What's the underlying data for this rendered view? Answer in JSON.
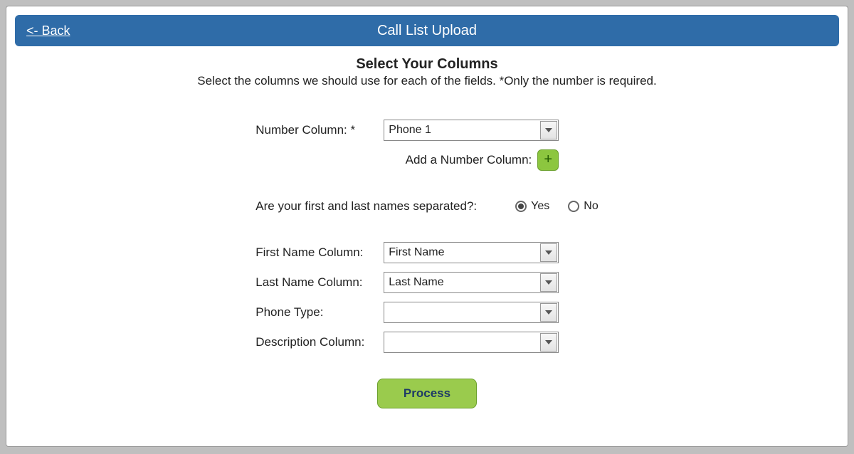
{
  "header": {
    "back_label": "<- Back",
    "title": "Call List Upload"
  },
  "section": {
    "title": "Select Your Columns",
    "subtitle": "Select the columns we should use for each of the fields. *Only the number is required."
  },
  "fields": {
    "number_column": {
      "label": "Number Column: *",
      "value": "Phone 1"
    },
    "add_number": {
      "label": "Add a Number Column:",
      "button": "+"
    },
    "names_separated": {
      "label": "Are your first and last names separated?:",
      "yes": "Yes",
      "no": "No",
      "selected": "yes"
    },
    "first_name": {
      "label": "First Name Column:",
      "value": "First Name"
    },
    "last_name": {
      "label": "Last Name Column:",
      "value": "Last Name"
    },
    "phone_type": {
      "label": "Phone Type:",
      "value": ""
    },
    "description": {
      "label": "Description Column:",
      "value": ""
    }
  },
  "actions": {
    "process": "Process"
  }
}
